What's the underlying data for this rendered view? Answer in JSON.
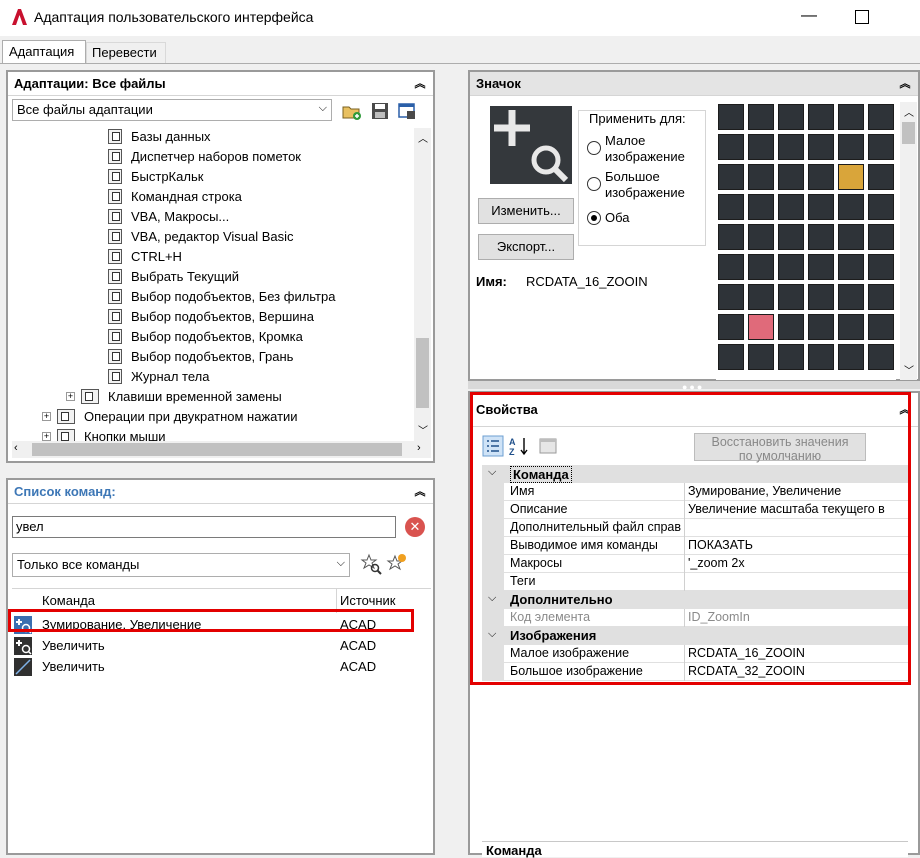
{
  "window": {
    "title": "Адаптация пользовательского интерфейса",
    "min": "—"
  },
  "tabs": [
    {
      "label": "Адаптация"
    },
    {
      "label": "Перевести"
    }
  ],
  "customizations": {
    "header": "Адаптации: Все файлы",
    "file_combo": "Все файлы адаптации",
    "tree": [
      "Базы данных",
      "Диспетчер наборов пометок",
      "БыстрКальк",
      "Командная строка",
      "VBA, Макросы...",
      "VBA, редактор Visual Basic",
      "CTRL+H",
      "Выбрать Текущий",
      "Выбор подобъектов, Без фильтра",
      "Выбор подобъектов, Вершина",
      "Выбор подобъектов, Кромка",
      "Выбор подобъектов, Грань",
      "Журнал тела",
      "Клавиши временной замены",
      "Операции при двукратном нажатии",
      "Кнопки мыши"
    ]
  },
  "command_list": {
    "header": "Список команд:",
    "search_value": "увел",
    "filter": "Только все команды",
    "columns": {
      "command": "Команда",
      "source": "Источник"
    },
    "rows": [
      {
        "name": "Зумирование, Увеличение",
        "source": "ACAD"
      },
      {
        "name": "Увеличить",
        "source": "ACAD"
      },
      {
        "name": "Увеличить",
        "source": "ACAD"
      }
    ]
  },
  "icon_panel": {
    "header": "Значок",
    "apply_for": "Применить для:",
    "small_1": "Малое",
    "small_2": "изображение",
    "large_1": "Большое",
    "large_2": "изображение",
    "both": "Оба",
    "selected": "both",
    "edit_btn": "Изменить...",
    "export_btn": "Экспорт...",
    "name_label": "Имя:",
    "name_value": "RCDATA_16_ZOOIN"
  },
  "properties": {
    "header": "Свойства",
    "restore_1": "Восстановить значения",
    "restore_2": "по умолчанию",
    "cat_command": "Команда",
    "cat_additional": "Дополнительно",
    "cat_images": "Изображения",
    "rows_command": [
      {
        "name": "Имя",
        "value": "Зумирование, Увеличение"
      },
      {
        "name": "Описание",
        "value": "Увеличение масштаба текущего в"
      },
      {
        "name": "Дополнительный файл справ",
        "value": ""
      },
      {
        "name": "Выводимое имя команды",
        "value": "ПОКАЗАТЬ"
      },
      {
        "name": "Макросы",
        "value": "'_zoom 2x"
      },
      {
        "name": "Теги",
        "value": ""
      }
    ],
    "rows_additional": [
      {
        "name": "Код элемента",
        "value": "ID_ZoomIn"
      }
    ],
    "rows_images": [
      {
        "name": "Малое изображение",
        "value": "RCDATA_16_ZOOIN"
      },
      {
        "name": "Большое изображение",
        "value": "RCDATA_32_ZOOIN"
      }
    ],
    "desc_title": "Команда"
  },
  "colors": {
    "highlight": "#e30000",
    "panel_title": "#3d77b6"
  }
}
